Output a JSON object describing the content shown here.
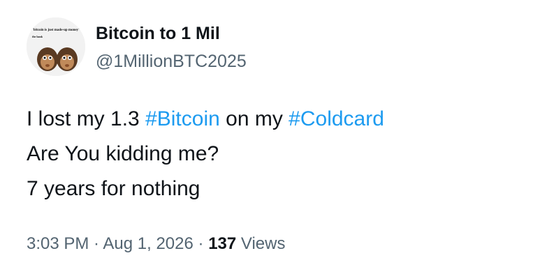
{
  "user": {
    "display_name": "Bitcoin to 1 Mil",
    "handle": "@1MillionBTC2025",
    "avatar_caption": "\"bitcoin is just made-up money\"",
    "avatar_subcaption": "the bank"
  },
  "tweet": {
    "line1_prefix": "I lost my 1.3 ",
    "line1_hashtag1": "#Bitcoin",
    "line1_middle": " on my ",
    "line1_hashtag2": "#Coldcard",
    "line2": "Are You kidding me?",
    "line3": "7 years for nothing"
  },
  "meta": {
    "time": "3:03 PM",
    "separator": " · ",
    "date": "Aug 1, 2026",
    "separator2": " · ",
    "views_count": "137",
    "views_label": " Views"
  },
  "colors": {
    "hashtag": "#1d9bf0",
    "secondary_text": "#536471",
    "primary_text": "#0f1419"
  }
}
